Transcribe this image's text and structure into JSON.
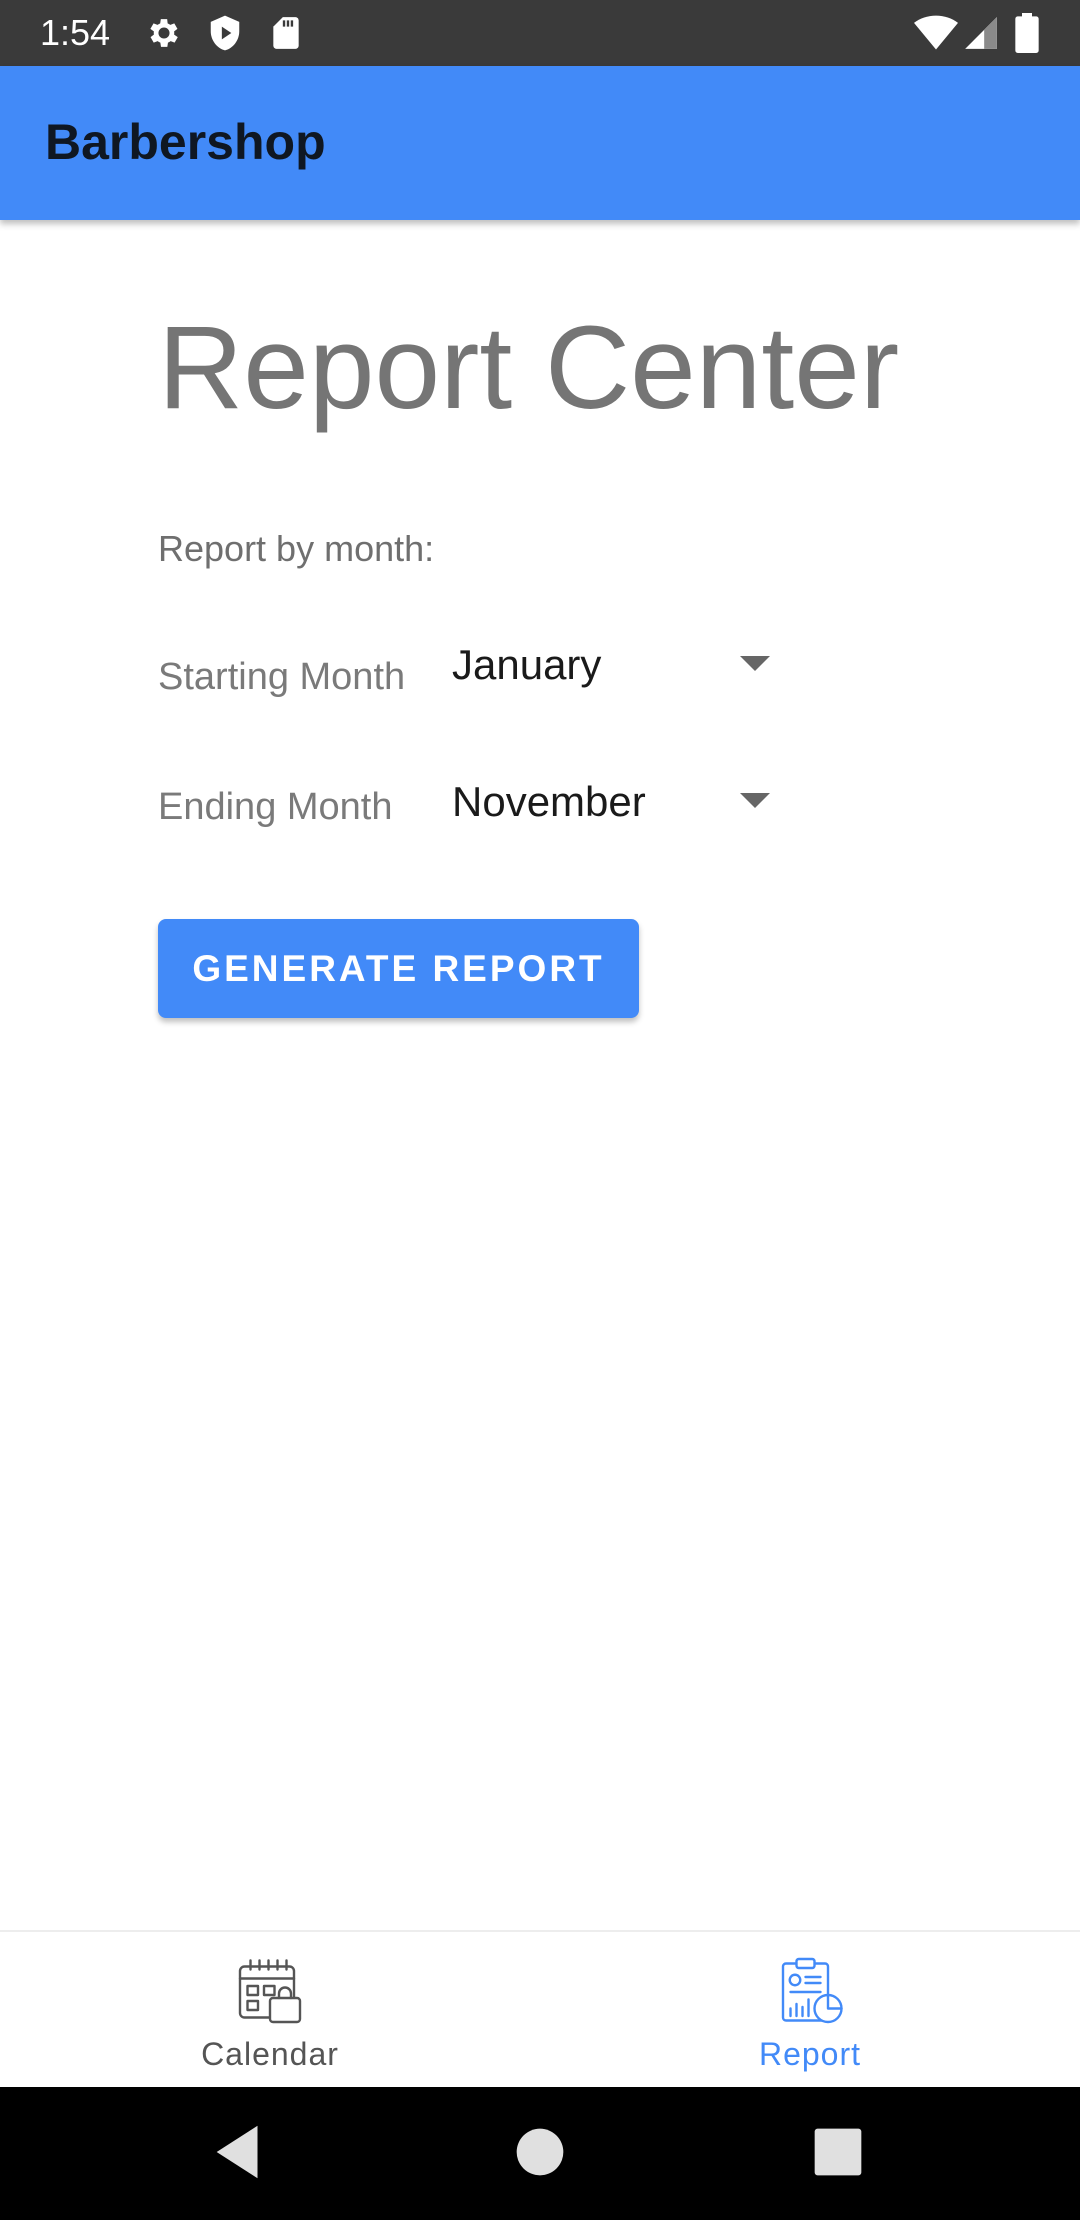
{
  "status_bar": {
    "time": "1:54",
    "left_icons": [
      "gear-icon",
      "shield-play-icon",
      "sd-card-icon"
    ],
    "right_icons": [
      "wifi-icon",
      "cell-signal-icon",
      "battery-icon"
    ]
  },
  "app_bar": {
    "title": "Barbershop",
    "background_color": "#428af8"
  },
  "report": {
    "title": "Report Center",
    "section_label": "Report by month:",
    "starting_month": {
      "label": "Starting Month",
      "value": "January"
    },
    "ending_month": {
      "label": "Ending Month",
      "value": "November"
    },
    "generate_button": "GENERATE REPORT"
  },
  "bottom_nav": {
    "items": [
      {
        "label": "Calendar",
        "icon": "calendar-icon",
        "active": false,
        "color": "#555555"
      },
      {
        "label": "Report",
        "icon": "report-clipboard-icon",
        "active": true,
        "color": "#428af8"
      }
    ]
  },
  "system_nav": {
    "buttons": [
      "back-icon",
      "home-icon",
      "recents-icon"
    ]
  }
}
